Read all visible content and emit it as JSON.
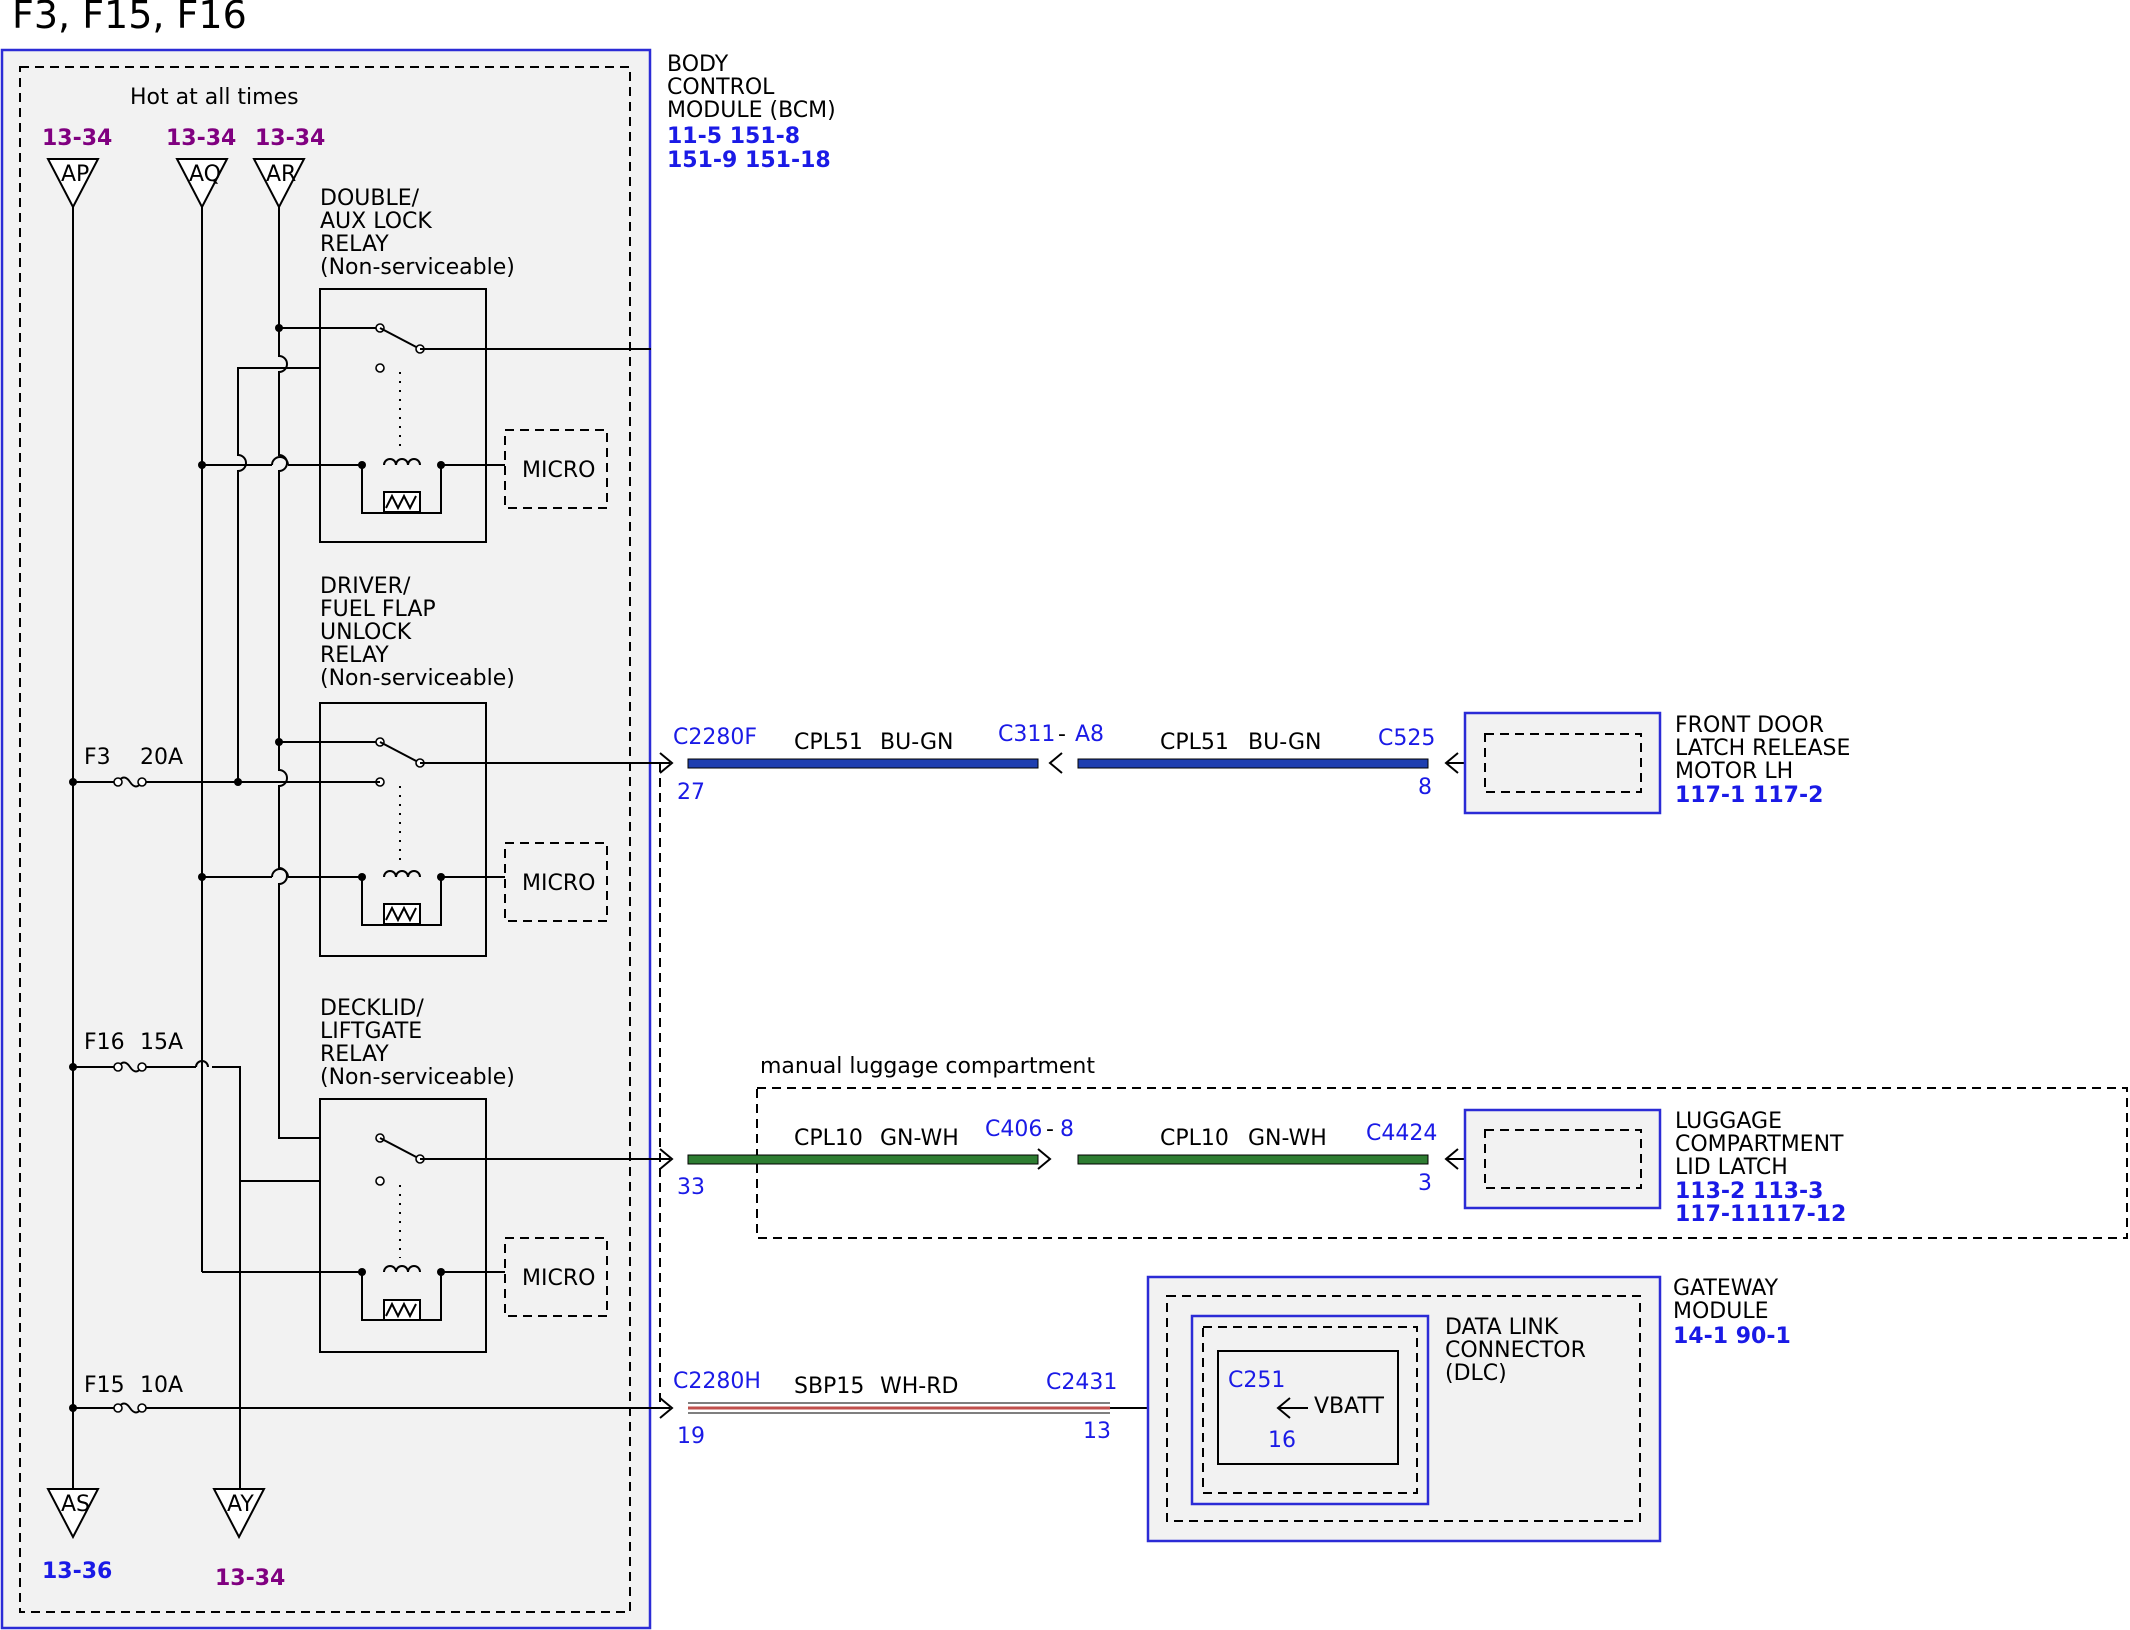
{
  "title": "F3, F15, F16",
  "hot_label": "Hot at all times",
  "colors": {
    "module_border": "#2b2bd6",
    "ref_blue": "#1a1ae6",
    "ref_purple": "#800080",
    "wire_blue": "#1f3fb0",
    "wire_green": "#2e7d32",
    "wire_wh_rd": "#c0504d",
    "fill_gray": "#f2f2f2"
  },
  "bcm": {
    "lines": [
      "BODY",
      "CONTROL",
      "MODULE (BCM)"
    ],
    "refs": [
      "11-5  151-8",
      "151-9  151-18"
    ]
  },
  "feeds_top": [
    {
      "ref": "13-34",
      "pin": "AP"
    },
    {
      "ref": "13-34",
      "pin": "AQ"
    },
    {
      "ref": "13-34",
      "pin": "AR"
    }
  ],
  "feeds_bottom": [
    {
      "ref": "13-36",
      "pin": "AS"
    },
    {
      "ref": "13-34",
      "pin": "AY"
    }
  ],
  "relays": [
    {
      "lines": [
        "DOUBLE/",
        "AUX LOCK",
        "RELAY",
        "(Non-serviceable)"
      ],
      "micro": "MICRO"
    },
    {
      "lines": [
        "DRIVER/",
        "FUEL FLAP",
        "UNLOCK",
        "RELAY",
        "(Non-serviceable)"
      ],
      "micro": "MICRO"
    },
    {
      "lines": [
        "DECKLID/",
        "LIFTGATE",
        "RELAY",
        "(Non-serviceable)"
      ],
      "micro": "MICRO"
    }
  ],
  "fuses": [
    {
      "name": "F3",
      "rating": "20A"
    },
    {
      "name": "F16",
      "rating": "15A"
    },
    {
      "name": "F15",
      "rating": "10A"
    }
  ],
  "circuits": [
    {
      "conn_left": "C2280F",
      "pin_left": "27",
      "circuit1": "CPL51",
      "color1": "BU-GN",
      "inline": "C311",
      "inline_pin": "A8",
      "circuit2": "CPL51",
      "color2": "BU-GN",
      "conn_right": "C525",
      "pin_right": "8"
    },
    {
      "conn_left": "",
      "pin_left": "33",
      "circuit1": "CPL10",
      "color1": "GN-WH",
      "inline": "C406",
      "inline_pin": "8",
      "circuit2": "CPL10",
      "color2": "GN-WH",
      "conn_right": "C4424",
      "pin_right": "3"
    },
    {
      "conn_left": "C2280H",
      "pin_left": "19",
      "circuit1": "SBP15",
      "color1": "WH-RD",
      "conn_right": "C2431",
      "pin_right": "13"
    }
  ],
  "front_door": {
    "lines": [
      "FRONT DOOR",
      "LATCH RELEASE",
      "MOTOR LH"
    ],
    "refs": "117-1 117-2"
  },
  "luggage_area": "manual luggage compartment",
  "luggage_latch": {
    "lines": [
      "LUGGAGE",
      "COMPARTMENT",
      "LID LATCH"
    ],
    "refs": [
      "113-2 113-3",
      "117-11117-12"
    ]
  },
  "gateway": {
    "lines": [
      "GATEWAY",
      "MODULE"
    ],
    "refs": "14-1  90-1"
  },
  "dlc": {
    "lines": [
      "DATA LINK",
      "CONNECTOR",
      "(DLC)"
    ],
    "conn": "C251",
    "pin": "16",
    "label": "VBATT"
  }
}
